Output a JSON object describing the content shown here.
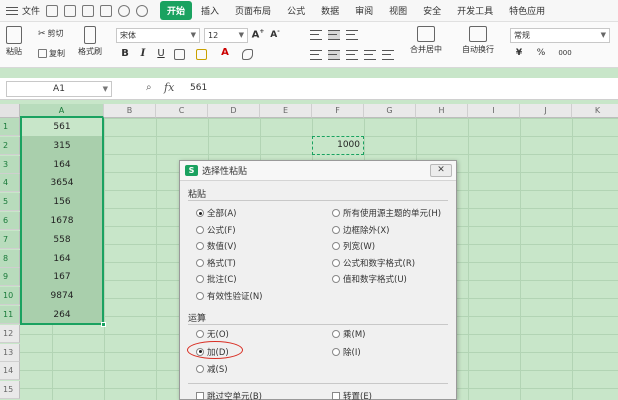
{
  "menubar": {
    "file_label": "文件",
    "tabs": [
      {
        "label": "开始",
        "active": true
      },
      {
        "label": "插入"
      },
      {
        "label": "页面布局"
      },
      {
        "label": "公式"
      },
      {
        "label": "数据"
      },
      {
        "label": "审阅"
      },
      {
        "label": "视图"
      },
      {
        "label": "安全"
      },
      {
        "label": "开发工具"
      },
      {
        "label": "特色应用"
      }
    ]
  },
  "ribbon": {
    "paste_label": "粘贴",
    "cut_label": "剪切",
    "copy_label": "复制",
    "format_painter_label": "格式刷",
    "font_name": "宋体",
    "font_size": "12",
    "bold": "B",
    "italic": "I",
    "underline": "U",
    "merge_center_label": "合并居中",
    "wrap_text_label": "自动换行",
    "number_format": "常规",
    "percent": "%",
    "thousands": "000"
  },
  "formula_bar": {
    "name_box": "A1",
    "fx_label": "fx",
    "value": "561"
  },
  "grid": {
    "columns": [
      "A",
      "B",
      "C",
      "D",
      "E",
      "F",
      "G",
      "H",
      "I",
      "J",
      "K"
    ],
    "rows": [
      "1",
      "2",
      "3",
      "4",
      "5",
      "6",
      "7",
      "8",
      "9",
      "10",
      "11",
      "12",
      "13",
      "14",
      "15"
    ],
    "column_a_values": [
      "561",
      "315",
      "164",
      "3654",
      "156",
      "1678",
      "558",
      "164",
      "167",
      "9874",
      "264"
    ],
    "copied_cell_value": "1000"
  },
  "dialog": {
    "title": "选择性粘贴",
    "close_label": "✕",
    "paste_section": "粘贴",
    "paste_options_left": [
      "全部(A)",
      "公式(F)",
      "数值(V)",
      "格式(T)",
      "批注(C)",
      "有效性验证(N)"
    ],
    "paste_options_right": [
      "所有使用源主题的单元(H)",
      "边框除外(X)",
      "列宽(W)",
      "公式和数字格式(R)",
      "值和数字格式(U)"
    ],
    "operation_section": "运算",
    "operation_options_left": [
      "无(O)",
      "加(D)",
      "减(S)"
    ],
    "operation_options_right": [
      "乘(M)",
      "除(I)"
    ],
    "skip_blanks_label": "跳过空单元(B)",
    "transpose_label": "转置(E)"
  },
  "colors": {
    "accent": "#1aa260",
    "sheet_background": "#c8e6c9",
    "highlight_ring": "#d93025"
  }
}
